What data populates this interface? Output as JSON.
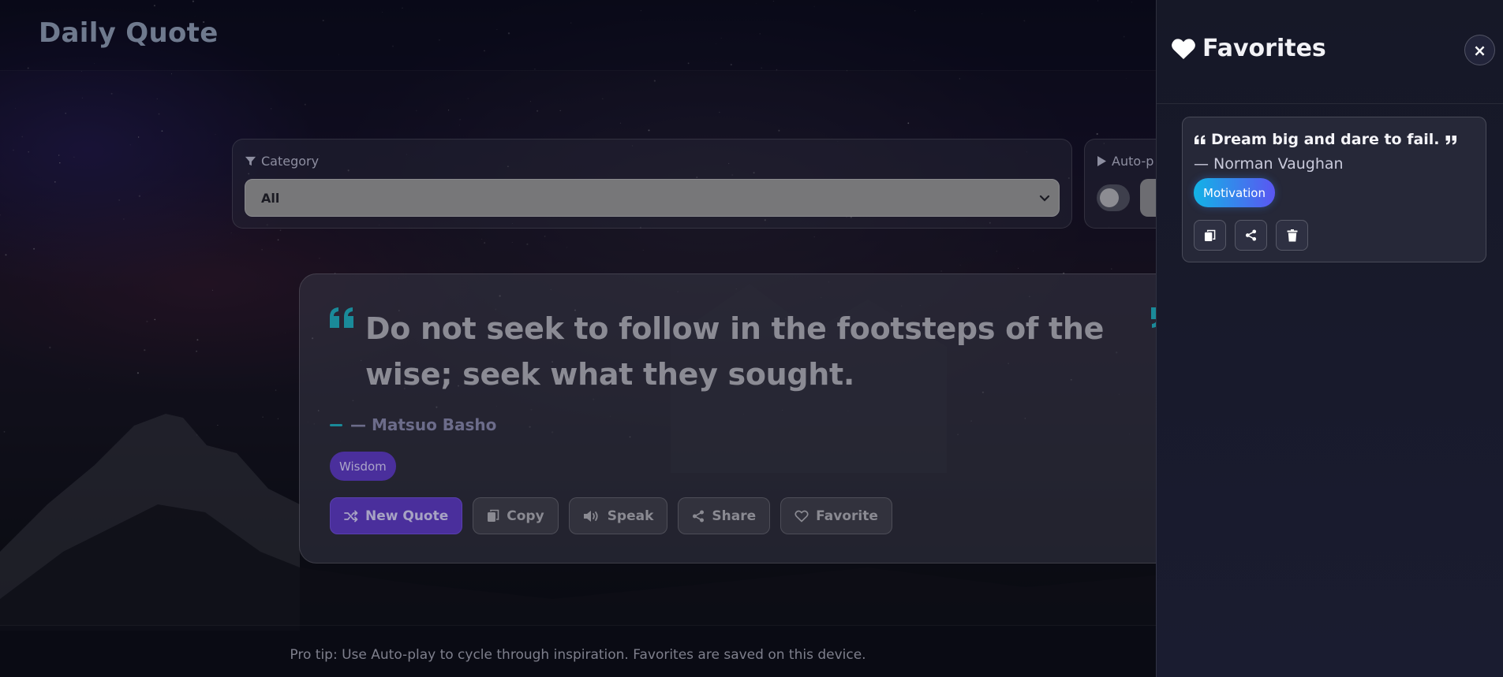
{
  "app": {
    "title": "Daily Quote"
  },
  "controls": {
    "category_label": "Category",
    "category_value": "All",
    "autoplay_label": "Auto-p",
    "autoplay_on": false
  },
  "quote": {
    "text": "Do not seek to follow in the footsteps of the wise; seek what they sought.",
    "author": "— Matsuo Basho",
    "category": "Wisdom"
  },
  "actions": {
    "new_quote": "New Quote",
    "copy": "Copy",
    "speak": "Speak",
    "share": "Share",
    "favorite": "Favorite"
  },
  "footer": {
    "tip": "Pro tip: Use Auto-play to cycle through inspiration. Favorites are saved on this device."
  },
  "favorites": {
    "title": "Favorites",
    "close_label": "×",
    "items": [
      {
        "text": "Dream big and dare to fail.",
        "author": "— Norman Vaughan",
        "category": "Motivation"
      }
    ]
  },
  "colors": {
    "accent_teal": "#1a8a99",
    "primary_purple": "#4a2f9c",
    "tag_gradient_start": "#12b3e6",
    "tag_gradient_end": "#5b56f2"
  },
  "icons": {
    "filter": "filter-icon",
    "play": "play-icon",
    "quote_open": "quote-open-icon",
    "quote_close": "quote-close-icon",
    "shuffle": "shuffle-icon",
    "copy": "copy-icon",
    "speaker": "speaker-icon",
    "share": "share-icon",
    "heart": "heart-icon",
    "trash": "trash-icon",
    "close": "close-icon"
  }
}
